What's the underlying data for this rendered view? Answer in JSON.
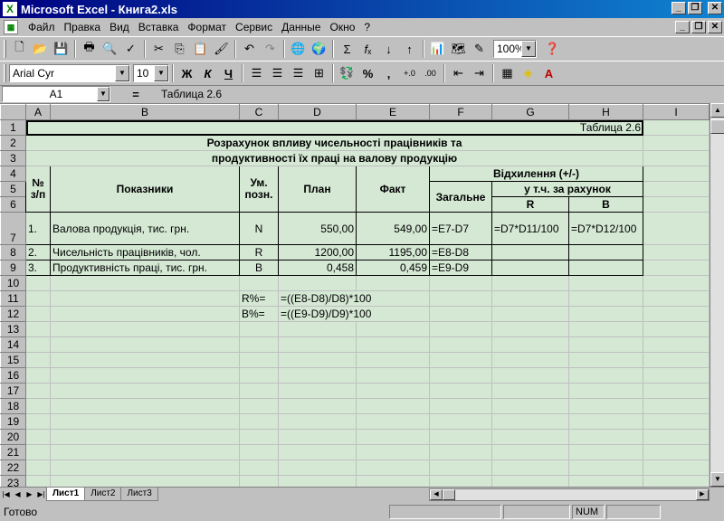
{
  "window": {
    "app_icon": "excel-icon",
    "title": "Microsoft Excel - Книга2.xls",
    "controls": [
      "minimize-icon",
      "restore-icon",
      "close-icon"
    ]
  },
  "menubar": {
    "items": [
      "Файл",
      "Правка",
      "Вид",
      "Вставка",
      "Формат",
      "Сервис",
      "Данные",
      "Окно",
      "?"
    ]
  },
  "toolbar_standard": {
    "zoom": "100%"
  },
  "toolbar_format": {
    "font": "Arial Cyr",
    "size": "10",
    "bold": "Ж",
    "italic": "К",
    "underline": "Ч",
    "percent": "%",
    "comma": ","
  },
  "formula_bar": {
    "cell_ref": "A1",
    "equals": "=",
    "content": "Таблица 2.6"
  },
  "columns": [
    "A",
    "B",
    "C",
    "D",
    "E",
    "F",
    "G",
    "H",
    "I"
  ],
  "rows": [
    "1",
    "2",
    "3",
    "4",
    "5",
    "6",
    "7",
    "8",
    "9",
    "10",
    "11",
    "12",
    "13",
    "14",
    "15",
    "16",
    "17",
    "18",
    "19",
    "20",
    "21",
    "22",
    "23"
  ],
  "cells": {
    "table_caption": "Таблица 2.6",
    "title_line1": "Розрахунок впливу чисельності працівників та",
    "title_line2": "продуктивності їх праці на валову продукцію",
    "h_no": "№ з/п",
    "h_indicators": "Показники",
    "h_unit": "Ум. позн.",
    "h_plan": "План",
    "h_fact": "Факт",
    "h_deviation": "Відхилення (+/-)",
    "h_total": "Загальне",
    "h_incl": "у т.ч. за рахунок",
    "h_r": "R",
    "h_b": "B",
    "r7_no": "1.",
    "r7_name": "Валова продукція, тис. грн.",
    "r7_unit": "N",
    "r7_plan": "550,00",
    "r7_fact": "549,00",
    "r7_total": "=E7-D7",
    "r7_r": "=D7*D11/100",
    "r7_b": "=D7*D12/100",
    "r8_no": "2.",
    "r8_name": "Чисельність працівників, чол.",
    "r8_unit": "R",
    "r8_plan": "1200,00",
    "r8_fact": "1195,00",
    "r8_total": "=E8-D8",
    "r9_no": "3.",
    "r9_name": "Продуктивність праці, тис. грн.",
    "r9_unit": "B",
    "r9_plan": "0,458",
    "r9_fact": "0,459",
    "r9_total": "=E9-D9",
    "r11_label": "R%=",
    "r11_formula": "=((E8-D8)/D8)*100",
    "r12_label": "B%=",
    "r12_formula": "=((E9-D9)/D9)*100"
  },
  "sheet_tabs": [
    "Лист1",
    "Лист2",
    "Лист3"
  ],
  "statusbar": {
    "status": "Готово",
    "num": "NUM"
  }
}
